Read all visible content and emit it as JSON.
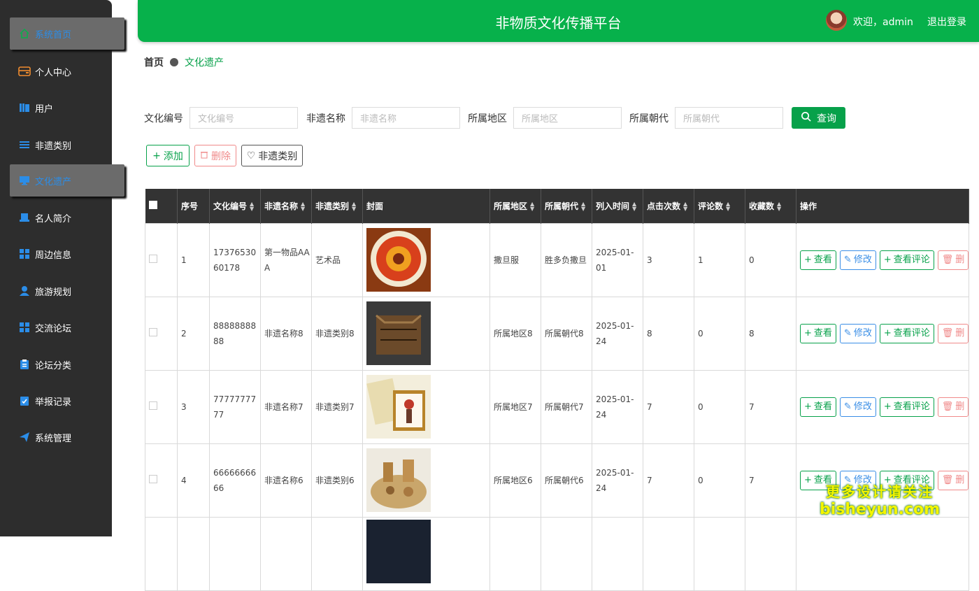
{
  "sidebar": {
    "items": [
      {
        "label": "系统首页",
        "icon": "home-icon",
        "active": true
      },
      {
        "label": "个人中心",
        "icon": "wallet-icon",
        "active": false
      },
      {
        "label": "用户",
        "icon": "books-icon",
        "active": false
      },
      {
        "label": "非遗类别",
        "icon": "list-icon",
        "active": false
      },
      {
        "label": "文化遗产",
        "icon": "monitor-icon",
        "active": true
      },
      {
        "label": "名人简介",
        "icon": "laptop-icon",
        "active": false
      },
      {
        "label": "周边信息",
        "icon": "grid-icon",
        "active": false
      },
      {
        "label": "旅游规划",
        "icon": "user-icon",
        "active": false
      },
      {
        "label": "交流论坛",
        "icon": "grid-icon",
        "active": false
      },
      {
        "label": "论坛分类",
        "icon": "clipboard-icon",
        "active": false
      },
      {
        "label": "举报记录",
        "icon": "check-clipboard-icon",
        "active": false
      },
      {
        "label": "系统管理",
        "icon": "send-icon",
        "active": false
      }
    ]
  },
  "header": {
    "title": "非物质文化传播平台",
    "welcome": "欢迎，admin",
    "logout": "退出登录"
  },
  "breadcrumb": {
    "home": "首页",
    "current": "文化遗产"
  },
  "search": {
    "fields": [
      {
        "label": "文化编号",
        "placeholder": "文化编号"
      },
      {
        "label": "非遗名称",
        "placeholder": "非遗名称"
      },
      {
        "label": "所属地区",
        "placeholder": "所属地区"
      },
      {
        "label": "所属朝代",
        "placeholder": "所属朝代"
      }
    ],
    "button": "查询"
  },
  "actions": {
    "add": "添加",
    "delete": "删除",
    "category": "非遗类别"
  },
  "table": {
    "headers": [
      "序号",
      "文化编号",
      "非遗名称",
      "非遗类别",
      "封面",
      "所属地区",
      "所属朝代",
      "列入时间",
      "点击次数",
      "评论数",
      "收藏数",
      "操作"
    ],
    "rows": [
      {
        "no": "1",
        "code": "1737653060178",
        "name": "第一物品AAA",
        "category": "艺术品",
        "region": "撒旦服",
        "dynasty": "胜多负撒旦",
        "date": "2025-01-01",
        "clicks": "3",
        "comments": "1",
        "favs": "0"
      },
      {
        "no": "2",
        "code": "8888888888",
        "name": "非遗名称8",
        "category": "非遗类别8",
        "region": "所属地区8",
        "dynasty": "所属朝代8",
        "date": "2025-01-24",
        "clicks": "8",
        "comments": "0",
        "favs": "8"
      },
      {
        "no": "3",
        "code": "7777777777",
        "name": "非遗名称7",
        "category": "非遗类别7",
        "region": "所属地区7",
        "dynasty": "所属朝代7",
        "date": "2025-01-24",
        "clicks": "7",
        "comments": "0",
        "favs": "7"
      },
      {
        "no": "4",
        "code": "6666666666",
        "name": "非遗名称6",
        "category": "非遗类别6",
        "region": "所属地区6",
        "dynasty": "所属朝代6",
        "date": "2025-01-24",
        "clicks": "7",
        "comments": "0",
        "favs": "7"
      }
    ],
    "ops": {
      "view": "查看",
      "edit": "修改",
      "comments": "查看评论",
      "delete": "删"
    }
  },
  "watermark": {
    "line1": "更多设计请关注",
    "line2": "bisheyun.com"
  },
  "colors": {
    "primary": "#07b14b",
    "sidebar": "#2d2d2d",
    "active_text": "#2b8de8",
    "danger": "#f08a8a",
    "info": "#3a8ee6"
  }
}
